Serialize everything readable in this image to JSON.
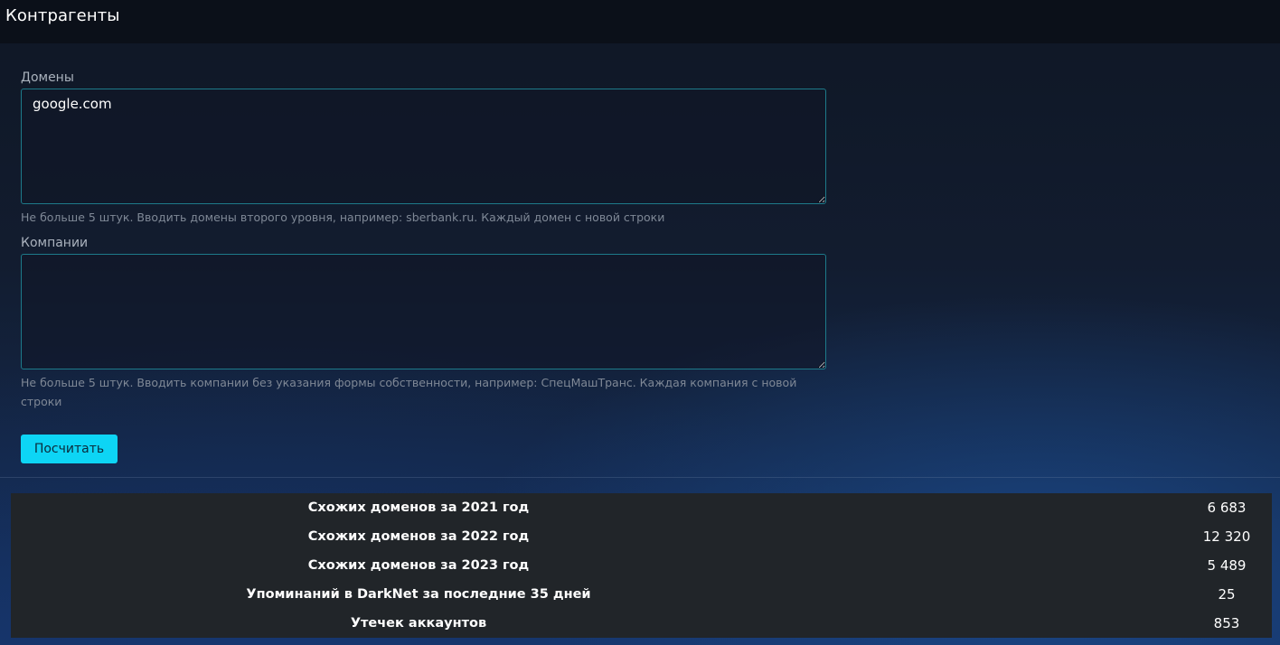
{
  "header": {
    "title": "Контрагенты"
  },
  "form": {
    "domains": {
      "label": "Домены",
      "value": "google.com",
      "help": "Не больше 5 штук. Вводить домены второго уровня, например: sberbank.ru. Каждый домен с новой строки"
    },
    "companies": {
      "label": "Компании",
      "value": "",
      "help": "Не больше 5 штук. Вводить компании без указания формы собственности, например: СпецМашТранс. Каждая компания с новой строки"
    },
    "submit_label": "Посчитать"
  },
  "stats": {
    "rows": [
      {
        "label": "Схожих доменов за 2021 год",
        "value": "6 683"
      },
      {
        "label": "Схожих доменов за 2022 год",
        "value": "12 320"
      },
      {
        "label": "Схожих доменов за 2023 год",
        "value": "5 489"
      },
      {
        "label": "Упоминаний в DarkNet за последние 35 дней",
        "value": "25"
      },
      {
        "label": "Утечек аккаунтов",
        "value": "853"
      }
    ]
  },
  "colors": {
    "accent": "#0dd5f5",
    "input_border": "#1d7a8a",
    "stats_bg": "#212529"
  }
}
